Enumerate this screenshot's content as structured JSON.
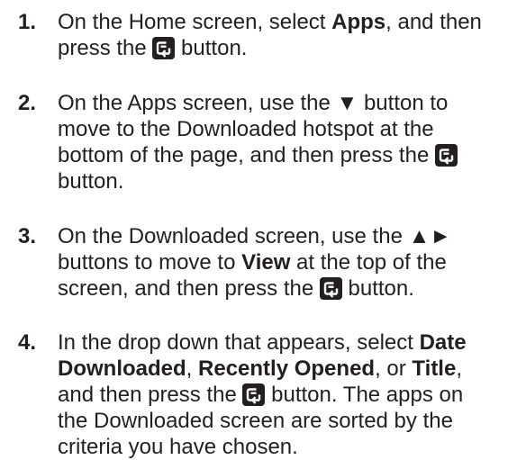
{
  "steps": [
    {
      "number": "1.",
      "lines": [
        [
          "On the Home screen, select ",
          {
            "b": "Apps"
          },
          ", and then"
        ],
        [
          "press the ",
          {
            "icon": "enter"
          },
          " button."
        ]
      ]
    },
    {
      "number": "2.",
      "lines": [
        [
          "On the Apps screen, use the ▼ button to"
        ],
        [
          "move to the Downloaded hotspot at the"
        ],
        [
          "bottom of the page, and then press the ",
          {
            "icon": "enter"
          }
        ],
        [
          "button."
        ]
      ]
    },
    {
      "number": "3.",
      "lines": [
        [
          "On the Downloaded screen, use the ▲►"
        ],
        [
          "buttons to move to ",
          {
            "b": "View"
          },
          " at the top of the"
        ],
        [
          "screen, and then press the ",
          {
            "icon": "enter"
          },
          " button."
        ]
      ]
    },
    {
      "number": "4.",
      "lines": [
        [
          "In the drop down that appears, select ",
          {
            "b": "Date"
          }
        ],
        [
          {
            "b": "Downloaded"
          },
          ", ",
          {
            "b": "Recently Opened"
          },
          ", or ",
          {
            "b": "Title"
          },
          ","
        ],
        [
          "and then press the ",
          {
            "icon": "enter"
          },
          " button. The apps on"
        ],
        [
          "the Downloaded screen are sorted by the"
        ],
        [
          "criteria you have chosen."
        ]
      ]
    }
  ]
}
